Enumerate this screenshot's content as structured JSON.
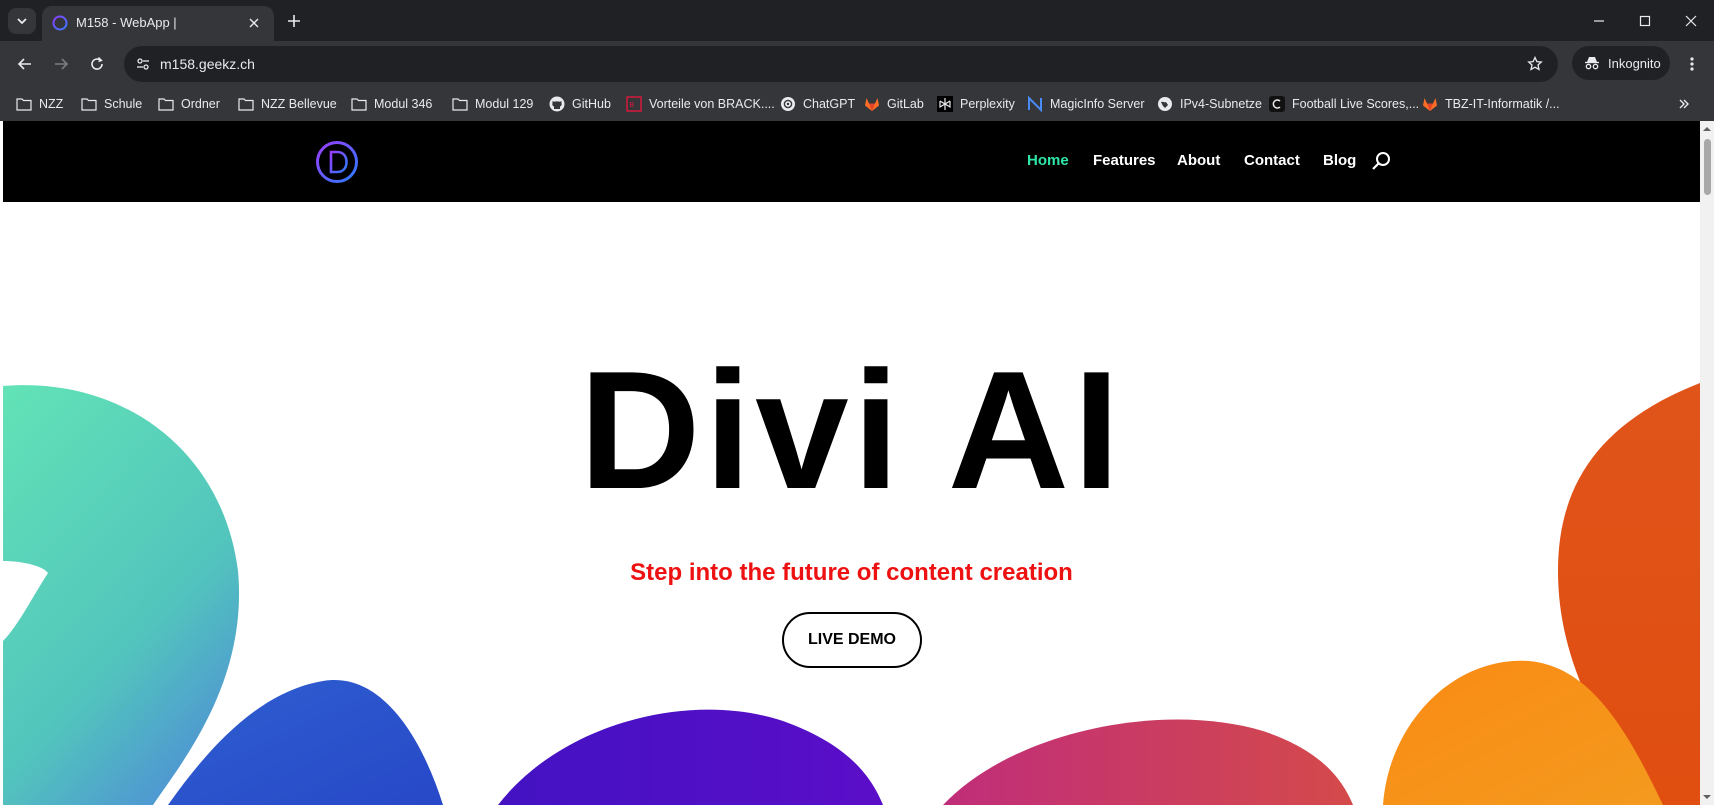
{
  "browser": {
    "tab": {
      "title": "M158 - WebApp |"
    },
    "url": "m158.geekz.ch",
    "incognito_label": "Inkognito",
    "bookmarks": [
      {
        "label": "NZZ",
        "icon": "folder-icon"
      },
      {
        "label": "Schule",
        "icon": "folder-icon"
      },
      {
        "label": "Ordner",
        "icon": "folder-icon"
      },
      {
        "label": "NZZ Bellevue",
        "icon": "folder-icon"
      },
      {
        "label": "Modul 346",
        "icon": "folder-icon"
      },
      {
        "label": "Modul 129",
        "icon": "folder-icon"
      },
      {
        "label": "GitHub",
        "icon": "github-icon"
      },
      {
        "label": "Vorteile von BRACK....",
        "icon": "brack-icon"
      },
      {
        "label": "ChatGPT",
        "icon": "chatgpt-icon"
      },
      {
        "label": "GitLab",
        "icon": "gitlab-icon"
      },
      {
        "label": "Perplexity",
        "icon": "perplexity-icon"
      },
      {
        "label": "MagicInfo Server",
        "icon": "magicinfo-icon"
      },
      {
        "label": "IPv4-Subnetze",
        "icon": "globe-icon"
      },
      {
        "label": "Football Live Scores,...",
        "icon": "football-icon"
      },
      {
        "label": "TBZ-IT-Informatik /...",
        "icon": "gitlab-icon"
      }
    ]
  },
  "site": {
    "nav": [
      {
        "label": "Home",
        "active": true
      },
      {
        "label": "Features",
        "active": false
      },
      {
        "label": "About",
        "active": false
      },
      {
        "label": "Contact",
        "active": false
      },
      {
        "label": "Blog",
        "active": false
      }
    ],
    "hero": {
      "title": "Divi AI",
      "subtitle": "Step into the future of content creation",
      "cta": "LIVE DEMO"
    },
    "colors": {
      "nav_active": "#2ee6a8",
      "subtitle": "#ee1111",
      "header_bg": "#000000"
    }
  }
}
